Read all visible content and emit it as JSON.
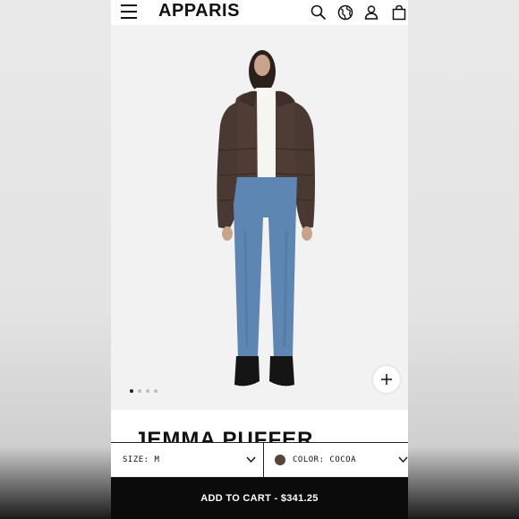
{
  "header": {
    "brand": "APPARIS",
    "icons": [
      "menu-icon",
      "search-icon",
      "globe-icon",
      "account-icon",
      "bag-icon"
    ]
  },
  "gallery": {
    "image_count": 4,
    "active_index": 0
  },
  "product": {
    "title": "JEMMA PUFFER"
  },
  "selectors": {
    "size_label": "SIZE: M",
    "color_label": "COLOR: COCOA",
    "color_hex": "#5a4438"
  },
  "cart": {
    "label": "ADD TO CART - $341.25"
  }
}
